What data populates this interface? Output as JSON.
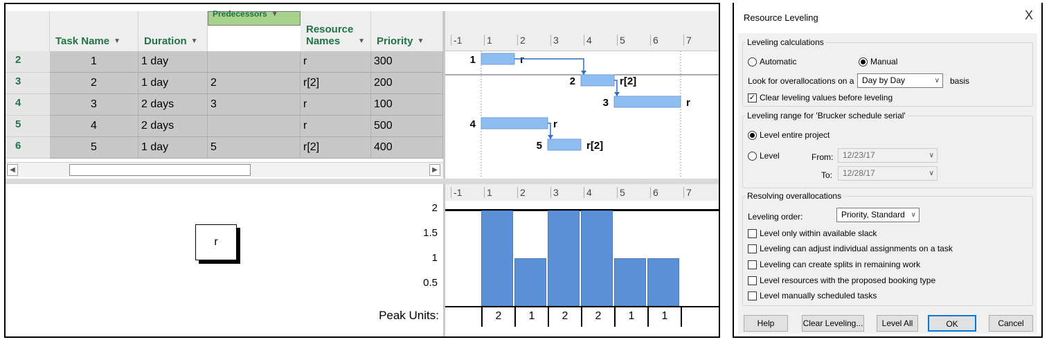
{
  "grid": {
    "columns": [
      {
        "label": "Task Name"
      },
      {
        "label": "Duration"
      },
      {
        "label": "Predecessors"
      },
      {
        "label_line1": "Resource",
        "label_line2": "Names"
      },
      {
        "label": "Priority"
      }
    ],
    "rows": [
      {
        "id": "2",
        "name": "1",
        "duration": "1 day",
        "pred": "",
        "resource": "r",
        "priority": "300"
      },
      {
        "id": "3",
        "name": "2",
        "duration": "1 day",
        "pred": "2",
        "resource": "r[2]",
        "priority": "200"
      },
      {
        "id": "4",
        "name": "3",
        "duration": "2 days",
        "pred": "3",
        "resource": "r",
        "priority": "100"
      },
      {
        "id": "5",
        "name": "4",
        "duration": "2 days",
        "pred": "",
        "resource": "r",
        "priority": "500"
      },
      {
        "id": "6",
        "name": "5",
        "duration": "1 day",
        "pred": "5",
        "resource": "r[2]",
        "priority": "400"
      }
    ]
  },
  "timescale": [
    "-1",
    "1",
    "2",
    "3",
    "4",
    "5",
    "6",
    "7"
  ],
  "gantt": {
    "bars": [
      {
        "task": "1",
        "start": 0,
        "end": 1,
        "label": "r"
      },
      {
        "task": "2",
        "start": 3,
        "end": 4,
        "label": "r[2]"
      },
      {
        "task": "3",
        "start": 4,
        "end": 6,
        "label": "r"
      },
      {
        "task": "4",
        "start": 0,
        "end": 2,
        "label": "r"
      },
      {
        "task": "5",
        "start": 2,
        "end": 3,
        "label": "r[2]"
      }
    ]
  },
  "resource_box": "r",
  "chart_data": {
    "type": "bar",
    "categories": [
      "1",
      "2",
      "3",
      "4",
      "5",
      "6"
    ],
    "values": [
      2,
      1,
      2,
      2,
      1,
      1
    ],
    "ylim": [
      0,
      2
    ],
    "yticks": [
      "2",
      "1.5",
      "1",
      "0.5"
    ],
    "peak_label": "Peak Units:",
    "peak_values": [
      "2",
      "1",
      "2",
      "2",
      "1",
      "1"
    ]
  },
  "dialog": {
    "title": "Resource Leveling",
    "close": "X",
    "calc_legend": "Leveling calculations",
    "automatic": "Automatic",
    "manual": "Manual",
    "look_for": "Look for overallocations on a",
    "basis_value": "Day by Day",
    "basis": "basis",
    "clear_values": "Clear leveling values before leveling",
    "range_legend": "Leveling range for 'Brucker schedule serial'",
    "level_entire": "Level entire project",
    "level": "Level",
    "from_label": "From:",
    "from_value": "12/23/17",
    "to_label": "To:",
    "to_value": "12/28/17",
    "resolve_legend": "Resolving overallocations",
    "order_label": "Leveling order:",
    "order_value": "Priority, Standard",
    "options": [
      "Level only within available slack",
      "Leveling can adjust individual assignments on a task",
      "Leveling can create splits in remaining work",
      "Level resources with the proposed booking type",
      "Level manually scheduled tasks"
    ],
    "buttons": {
      "help": "Help",
      "clear": "Clear Leveling...",
      "level_all": "Level All",
      "ok": "OK",
      "cancel": "Cancel"
    }
  }
}
